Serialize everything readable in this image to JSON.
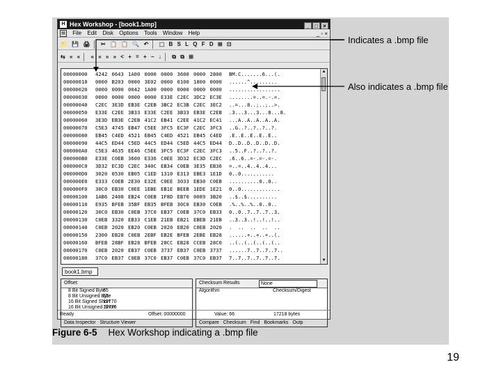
{
  "window": {
    "title": "Hex Workshop - [book1.bmp]",
    "min": "_",
    "max": "□",
    "close": "×"
  },
  "menu": [
    "File",
    "Edit",
    "Disk",
    "Options",
    "Tools",
    "Window",
    "Help"
  ],
  "mdi_buttons": "_ ▫ ×",
  "toolbar1": [
    "📁",
    "💾",
    "🖨",
    "✂",
    "📋",
    "📋",
    "🔍",
    "↶",
    "⬚",
    "B",
    "S",
    "L",
    "Q",
    "F",
    "D",
    "⊞",
    "⊡"
  ],
  "toolbar2": [
    "⇆",
    "«",
    "«",
    "«",
    "«",
    "»",
    "»",
    "<",
    "+",
    "=",
    "+",
    "~",
    "↓",
    "⧉",
    "⧉",
    "⊞"
  ],
  "hex_rows": [
    {
      "offset": "00000000",
      "cols": [
        "4242",
        "0643",
        "1A00",
        "0000",
        "0000",
        "3600",
        "0000",
        "2800"
      ],
      "ascii": "BM.C.......6...(."
    },
    {
      "offset": "00000010",
      "cols": [
        "0000",
        "B203",
        "0000",
        "3E02",
        "0000",
        "0100",
        "1800",
        "0000"
      ],
      "ascii": "......^........."
    },
    {
      "offset": "00000020",
      "cols": [
        "0000",
        "0000",
        "0042",
        "1A00",
        "0000",
        "0000",
        "0000",
        "0000"
      ],
      "ascii": "................."
    },
    {
      "offset": "00000030",
      "cols": [
        "0000",
        "0000",
        "0000",
        "0000",
        "E33E",
        "C2EC",
        "3DC2",
        "EC3E"
      ],
      "ascii": "........=..=.-.=."
    },
    {
      "offset": "00000040",
      "cols": [
        "C2EC",
        "3E3D",
        "EB3E",
        "C2EB",
        "3BC2",
        "EC3B",
        "C2EC",
        "3EC2"
      ],
      "ascii": "..=...8..;..;..>."
    },
    {
      "offset": "00000050",
      "cols": [
        "E33E",
        "C2EE",
        "3B33",
        "E33E",
        "C2EE",
        "3B33",
        "EB3E",
        "C2EB"
      ],
      "ascii": ".3...3...3...8...8."
    },
    {
      "offset": "00000060",
      "cols": [
        "3E3D",
        "EB3E",
        "C2EB",
        "41C2",
        "EB41",
        "C2EE",
        "41C2",
        "EC41"
      ],
      "ascii": "...A..A..A..A..A."
    },
    {
      "offset": "00000070",
      "cols": [
        "C5E3",
        "4745",
        "EB47",
        "C5EE",
        "3FC5",
        "EC3F",
        "C2EC",
        "3FC3"
      ],
      "ascii": "..G..?..?..?..?."
    },
    {
      "offset": "00000080",
      "cols": [
        "EB45",
        "C4ED",
        "4521",
        "EB45",
        "C4ED",
        "4521",
        "EB45",
        "C4ED"
      ],
      "ascii": ".E..E..E..E..E.."
    },
    {
      "offset": "00000090",
      "cols": [
        "44C5",
        "ED44",
        "C5ED",
        "44C5",
        "ED44",
        "C5ED",
        "44C5",
        "ED44"
      ],
      "ascii": "D..D..D..D..D..D."
    },
    {
      "offset": "000000A0",
      "cols": [
        "C5E3",
        "4635",
        "EE46",
        "C5EE",
        "3FC5",
        "EC3F",
        "C2EC",
        "3FC3"
      ],
      "ascii": "..5..F..?..?..?."
    },
    {
      "offset": "000000B0",
      "cols": [
        "E33E",
        "C0EB",
        "3600",
        "E336",
        "C0EE",
        "3D32",
        "EC3D",
        "C2EC"
      ],
      "ascii": ".6..6..=-.=-.=-."
    },
    {
      "offset": "000000C0",
      "cols": [
        "3D32",
        "EC3D",
        "C2EC",
        "340C",
        "EB34",
        "C0EB",
        "3E35",
        "EB36"
      ],
      "ascii": "=..=..4..4..4..."
    },
    {
      "offset": "000000D0",
      "cols": [
        "3020",
        "0530",
        "EB05",
        "C1ED",
        "1310",
        "E313",
        "EBE3",
        "1E1D"
      ],
      "ascii": "0..0..........."
    },
    {
      "offset": "000000E0",
      "cols": [
        "E333",
        "C0EB",
        "2E30",
        "E32E",
        "C0EE",
        "3033",
        "EB30",
        "C0EB"
      ],
      "ascii": "..........0..0.."
    },
    {
      "offset": "000000F0",
      "cols": [
        "30C0",
        "EB30",
        "C0EE",
        "1EBE",
        "EB1E",
        "BEEB",
        "1EDE",
        "1E21"
      ],
      "ascii": "0..0............."
    },
    {
      "offset": "00000100",
      "cols": [
        "1AB6",
        "2408",
        "EB24",
        "C0EB",
        "1F8D",
        "EB70",
        "0089",
        "3B20"
      ],
      "ascii": "..$..$.........."
    },
    {
      "offset": "00000110",
      "cols": [
        "E935",
        "BFEB",
        "35BF",
        "EB35",
        "BFEB",
        "30C0",
        "EB30",
        "C0EB"
      ],
      "ascii": ".%..%..%..0..0.."
    },
    {
      "offset": "00000120",
      "cols": [
        "30C0",
        "EB30",
        "C0EB",
        "37C0",
        "EB37",
        "C0EB",
        "37C0",
        "EB33"
      ],
      "ascii": "0..0..7..7..7..3."
    },
    {
      "offset": "00000130",
      "cols": [
        "C0EB",
        "3320",
        "EB33",
        "C1EB",
        "21EB",
        "EB21",
        "EBEB",
        "21EB"
      ],
      "ascii": "..3..3..!..!..!.."
    },
    {
      "offset": "00000140",
      "cols": [
        "C0EB",
        "2020",
        "EB20",
        "C0EB",
        "2020",
        "EB20",
        "C0EB",
        "2020"
      ],
      "ascii": ".  ..  ..  ..  .."
    },
    {
      "offset": "00000150",
      "cols": [
        "2300",
        "EB28",
        "C0EB",
        "2EBF",
        "EB2E",
        "BFEB",
        "2EBE",
        "EB28"
      ],
      "ascii": "......+..+..+..(."
    },
    {
      "offset": "00000160",
      "cols": [
        "BFEB",
        "28BF",
        "EB28",
        "BFEB",
        "28CC",
        "EB28",
        "CCEB",
        "28C0"
      ],
      "ascii": "..(..(..(..(..(.."
    },
    {
      "offset": "00000170",
      "cols": [
        "C0EB",
        "2020",
        "EB37",
        "C0EB",
        "3737",
        "EB37",
        "C0EB",
        "3737"
      ],
      "ascii": "......7..7..7..7.."
    },
    {
      "offset": "00000180",
      "cols": [
        "37C0",
        "EB37",
        "C0EB",
        "37C0",
        "EB37",
        "C0EB",
        "37C0",
        "EB37"
      ],
      "ascii": "7..7..7..7..7..7."
    }
  ],
  "doc_tab": "book1.bmp",
  "left_pane": {
    "header": "Offset:",
    "rows": [
      {
        "label": "8 Bit Signed Byte",
        "value": "65"
      },
      {
        "label": "8 Bit Unsigned Byte",
        "value": "65"
      },
      {
        "label": "16 Bit Signed Short",
        "value": "19770"
      },
      {
        "label": "16 Bit Unsigned Short",
        "value": "19770"
      }
    ],
    "tabs": [
      "Data Inspector",
      "Structure Viewer"
    ]
  },
  "right_pane": {
    "header": "Checksum Results",
    "select_value": "None",
    "col1": "Algorithm",
    "col2": "Checksum/Digest",
    "tabs": [
      "Compare",
      "Checksum",
      "Find",
      "Bookmarks",
      "Outp"
    ]
  },
  "status": {
    "ready": "Ready",
    "offset": "Offset: 00000000",
    "value": "Value: 66",
    "size": "17218 bytes"
  },
  "annotations": {
    "first": "Indicates a .bmp file",
    "second": "Also indicates a .bmp file"
  },
  "caption": {
    "figure": "Figure 6-5",
    "text": "Hex Workshop indicating a .bmp file"
  },
  "page_number": "19"
}
